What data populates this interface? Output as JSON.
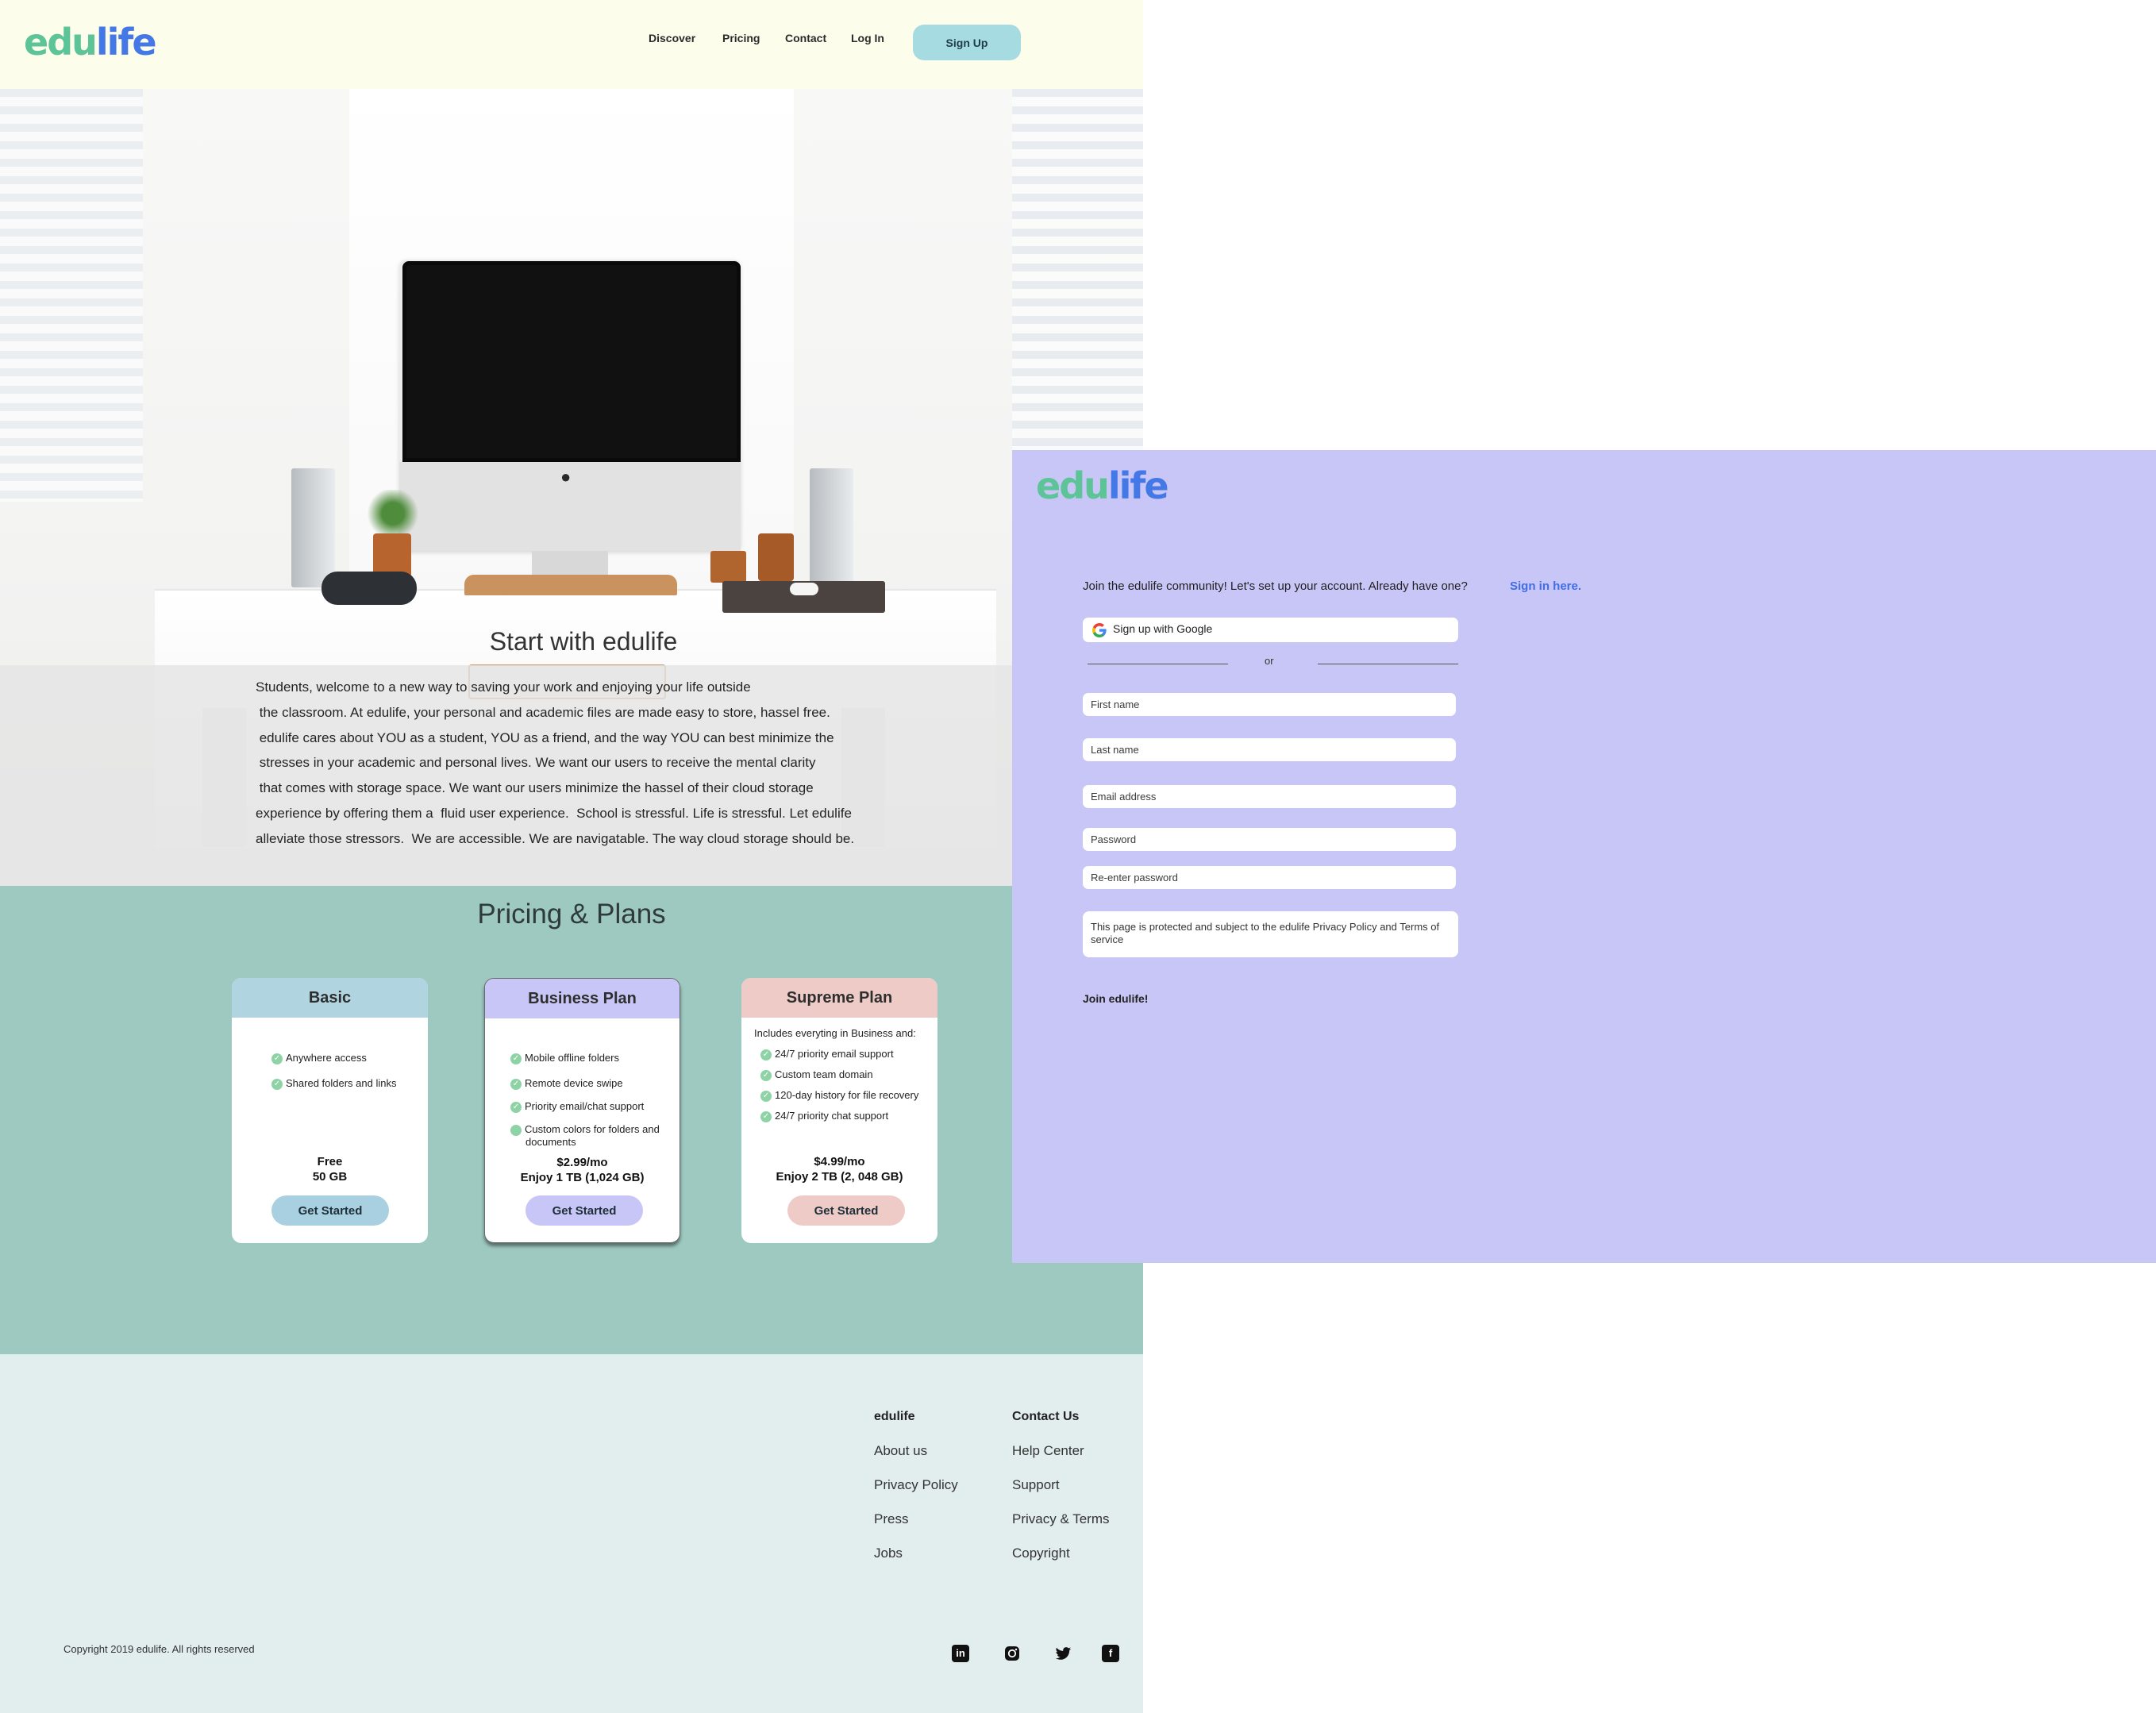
{
  "brand": {
    "edu": "edu",
    "life": "life",
    "logo_edu_color": "#5cc497",
    "logo_life_color": "#4478e6"
  },
  "nav": {
    "items": [
      "Discover",
      "Pricing",
      "Contact",
      "Log In"
    ],
    "signup_label": "Sign Up"
  },
  "hero": {
    "title": "Start with edulife",
    "text": "Students, welcome to a new way to saving your work and enjoying your life outside\n the classroom. At edulife, your personal and academic files are made easy to store, hassel free.\n edulife cares about YOU as a student, YOU as a friend, and the way YOU can best minimize the\n stresses in your academic and personal lives. We want our users to receive the mental clarity\n that comes with storage space. We want our users minimize the hassel of their cloud storage\nexperience by offering them a  fluid user experience.  School is stressful. Life is stressful. Let edulife\nalleviate those stressors.  We are accessible. We are navigatable. The way cloud storage should be."
  },
  "pricing": {
    "title": "Pricing & Plans",
    "plans": [
      {
        "name": "Basic",
        "intro": "",
        "features": [
          "Anywhere access",
          "Shared folders and links"
        ],
        "price": "Free",
        "storage": "50 GB",
        "cta": "Get Started",
        "color": "#b1d4e1"
      },
      {
        "name": "Business Plan",
        "intro": "",
        "features": [
          "Mobile offline folders",
          "Remote device swipe",
          "Priority email/chat support",
          "Custom colors for folders and documents"
        ],
        "price": "$2.99/mo",
        "storage": "Enjoy 1 TB (1,024 GB)",
        "cta": "Get Started",
        "color": "#c7c6f6"
      },
      {
        "name": "Supreme Plan",
        "intro": "Includes everyting in Business and:",
        "features": [
          "24/7 priority email support",
          "Custom team domain",
          "120-day history for file recovery",
          "24/7 priority chat support"
        ],
        "price": "$4.99/mo",
        "storage": "Enjoy 2 TB (2, 048 GB)",
        "cta": "Get Started",
        "color": "#eecbc7"
      }
    ]
  },
  "footer": {
    "col1": {
      "heading": "edulife",
      "links": [
        "About us",
        "Privacy Policy",
        "Press",
        "Jobs"
      ]
    },
    "col2": {
      "heading": "Contact Us",
      "links": [
        "Help Center",
        "Support",
        "Privacy & Terms",
        "Copyright"
      ]
    },
    "copyright": "Copyright 2019 edulife. All rights reserved",
    "social": [
      "linkedin-icon",
      "instagram-icon",
      "twitter-icon",
      "facebook-icon"
    ]
  },
  "signup": {
    "intro": "Join the edulife community! Let's set up your account. Already have one?",
    "signin_link": "Sign in here.",
    "google_label": "Sign up with Google",
    "or": "or",
    "fields": {
      "first": "First name",
      "last": "Last name",
      "email": "Email address",
      "password": "Password",
      "reenter": "Re-enter password"
    },
    "legal": "This page is protected and subject to the edulife Privacy Policy and Terms of service",
    "join_label": "Join edulife!",
    "bg_color": "#c7c6f6"
  }
}
